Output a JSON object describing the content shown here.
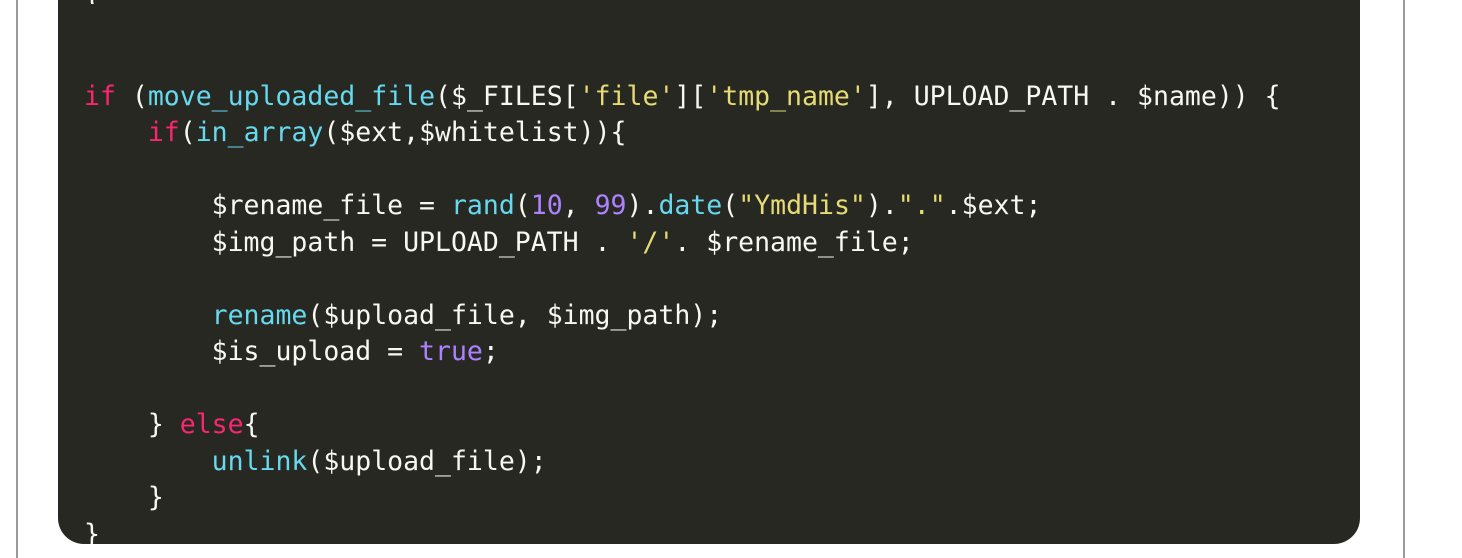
{
  "editor": {
    "theme": "monokai",
    "colors": {
      "background": "#272822",
      "keyword": "#f92672",
      "function": "#66d9ef",
      "string": "#e6db74",
      "number": "#ae81ff",
      "text": "#f8f8f2"
    },
    "cut_line_text": "}",
    "lines": [
      [],
      [
        {
          "t": "if",
          "c": "kw"
        },
        {
          "t": " (",
          "c": "pl"
        },
        {
          "t": "move_uploaded_file",
          "c": "fn"
        },
        {
          "t": "($_FILES[",
          "c": "pl"
        },
        {
          "t": "'file'",
          "c": "str"
        },
        {
          "t": "][",
          "c": "pl"
        },
        {
          "t": "'tmp_name'",
          "c": "str"
        },
        {
          "t": "], UPLOAD_PATH . $name)) {",
          "c": "pl"
        }
      ],
      [
        {
          "t": "    ",
          "c": "pl"
        },
        {
          "t": "if",
          "c": "kw"
        },
        {
          "t": "(",
          "c": "pl"
        },
        {
          "t": "in_array",
          "c": "fn"
        },
        {
          "t": "($ext,$whitelist)){",
          "c": "pl"
        }
      ],
      [],
      [
        {
          "t": "        $rename_file = ",
          "c": "pl"
        },
        {
          "t": "rand",
          "c": "fn"
        },
        {
          "t": "(",
          "c": "pl"
        },
        {
          "t": "10",
          "c": "num"
        },
        {
          "t": ", ",
          "c": "pl"
        },
        {
          "t": "99",
          "c": "num"
        },
        {
          "t": ").",
          "c": "pl"
        },
        {
          "t": "date",
          "c": "fn"
        },
        {
          "t": "(",
          "c": "pl"
        },
        {
          "t": "\"YmdHis\"",
          "c": "str"
        },
        {
          "t": ").",
          "c": "pl"
        },
        {
          "t": "\".\"",
          "c": "str"
        },
        {
          "t": ".$ext;",
          "c": "pl"
        }
      ],
      [
        {
          "t": "        $img_path = UPLOAD_PATH . ",
          "c": "pl"
        },
        {
          "t": "'/'",
          "c": "str"
        },
        {
          "t": ". $rename_file;",
          "c": "pl"
        }
      ],
      [],
      [
        {
          "t": "        ",
          "c": "pl"
        },
        {
          "t": "rename",
          "c": "fn"
        },
        {
          "t": "($upload_file, $img_path);",
          "c": "pl"
        }
      ],
      [
        {
          "t": "        $is_upload = ",
          "c": "pl"
        },
        {
          "t": "true",
          "c": "num"
        },
        {
          "t": ";",
          "c": "pl"
        }
      ],
      [],
      [
        {
          "t": "    } ",
          "c": "pl"
        },
        {
          "t": "else",
          "c": "kw"
        },
        {
          "t": "{",
          "c": "pl"
        }
      ],
      [
        {
          "t": "        ",
          "c": "pl"
        },
        {
          "t": "unlink",
          "c": "fn"
        },
        {
          "t": "($upload_file);",
          "c": "pl"
        }
      ],
      [
        {
          "t": "    }",
          "c": "pl"
        }
      ],
      [
        {
          "t": "}",
          "c": "pl"
        }
      ]
    ]
  }
}
